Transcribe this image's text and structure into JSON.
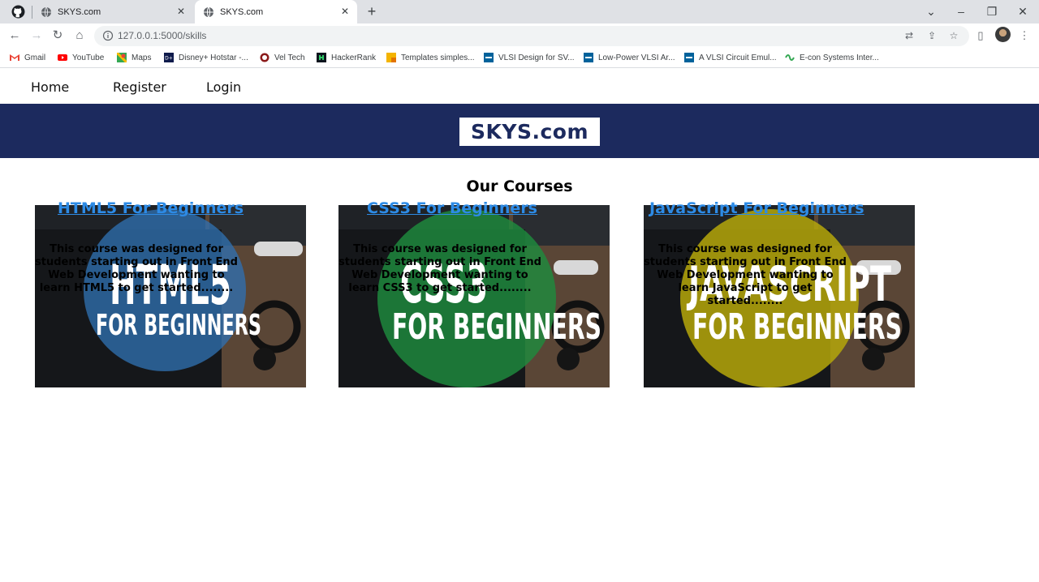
{
  "browser": {
    "tabs": [
      {
        "title": "SKYS.com",
        "active": false
      },
      {
        "title": "SKYS.com",
        "active": true
      }
    ],
    "url": "127.0.0.1:5000/skills",
    "bookmarks": [
      {
        "label": "Gmail",
        "icon": "gmail-icon"
      },
      {
        "label": "YouTube",
        "icon": "youtube-icon"
      },
      {
        "label": "Maps",
        "icon": "maps-icon"
      },
      {
        "label": "Disney+ Hotstar -...",
        "icon": "hotstar-icon"
      },
      {
        "label": "Vel Tech",
        "icon": "veltech-icon"
      },
      {
        "label": "HackerRank",
        "icon": "hackerrank-icon"
      },
      {
        "label": "Templates simples...",
        "icon": "templates-icon"
      },
      {
        "label": "VLSI Design for SV...",
        "icon": "ieee-icon"
      },
      {
        "label": "Low-Power VLSI Ar...",
        "icon": "ieee-icon"
      },
      {
        "label": "A VLSI Circuit Emul...",
        "icon": "ieee-icon"
      },
      {
        "label": "E-con Systems Inter...",
        "icon": "econ-icon"
      }
    ]
  },
  "nav": {
    "home": "Home",
    "register": "Register",
    "login": "Login"
  },
  "banner": {
    "logo": "SKYS.com",
    "color": "#1c2a5e"
  },
  "main": {
    "title": "Our Courses",
    "courses": [
      {
        "image_line1": "HTML5",
        "image_line2": "FOR BEGINNERS",
        "circle_color": "#2f6fb0",
        "link": "HTML5 For Beginners",
        "description": "This course was designed for students starting out in Front End Web Development wanting to learn HTML5 to get started........"
      },
      {
        "image_line1": "CSS3",
        "image_line2": "FOR BEGINNERS",
        "circle_color": "#1e8b3e",
        "link": "CSS3 For Beginners",
        "description": "This course was designed for students starting out in Front End Web Development wanting to learn CSS3 to get started........"
      },
      {
        "image_line1": "JAVASCRIPT",
        "image_line2": "FOR BEGINNERS",
        "circle_color": "#b5a70a",
        "link": "JavaScript For Beginners",
        "description": "This course was designed for students starting out in Front End Web Development wanting to learn JavaScript to get started........"
      }
    ]
  }
}
